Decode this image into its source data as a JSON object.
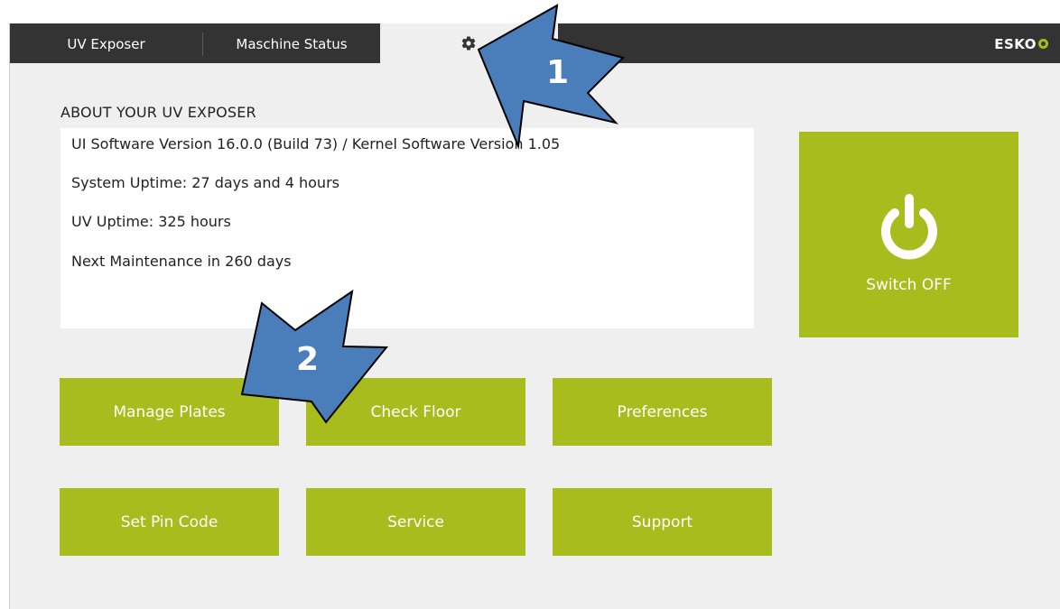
{
  "tabs": {
    "exposer_label": "UV Exposer",
    "status_label": "Maschine Status",
    "settings_icon": "gear-icon"
  },
  "brand": {
    "logo_text": "ESKO"
  },
  "about": {
    "title": "ABOUT YOUR UV EXPOSER",
    "lines": [
      "UI Software Version 16.0.0 (Build 73) / Kernel Software Version 1.05",
      "System Uptime: 27 days and 4 hours",
      "UV Uptime: 325 hours",
      "Next Maintenance in 260 days"
    ]
  },
  "switch": {
    "label": "Switch OFF",
    "icon": "power-icon"
  },
  "buttons": {
    "manage_plates": "Manage Plates",
    "check_floor": "Check Floor",
    "preferences": "Preferences",
    "set_pin_code": "Set Pin Code",
    "service": "Service",
    "support": "Support"
  },
  "callouts": {
    "one": "1",
    "two": "2"
  },
  "colors": {
    "accent_green": "#a8bd1d",
    "topbar": "#333333",
    "background": "#efefef",
    "callout_blue": "#4a7ebb"
  }
}
